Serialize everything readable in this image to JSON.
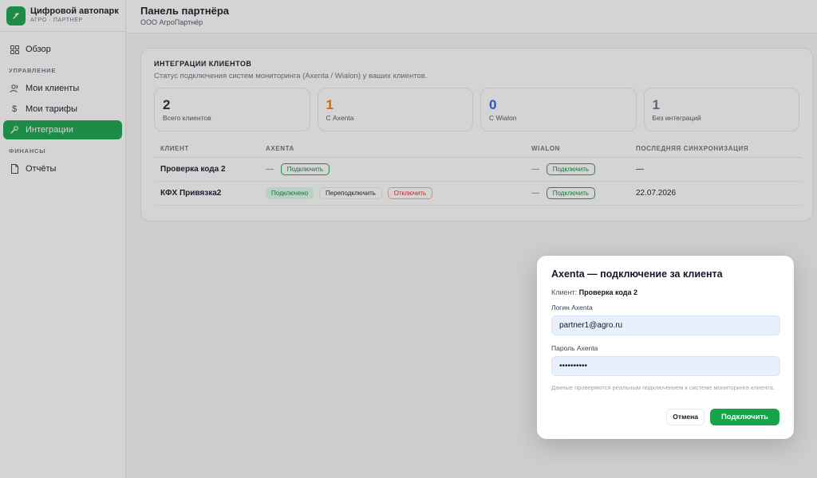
{
  "brand": {
    "title": "Цифровой автопарк",
    "subtitle": "АГРО · ПАРТНЁР"
  },
  "sidebar": {
    "overview": "Обзор",
    "section_manage": "УПРАВЛЕНИЕ",
    "my_clients": "Мои клиенты",
    "my_tariffs": "Мои тарифы",
    "integrations": "Интеграции",
    "section_finance": "ФИНАНСЫ",
    "reports": "Отчёты"
  },
  "header": {
    "title": "Панель партнёра",
    "org": "ООО АгроПартнёр"
  },
  "integrations": {
    "title": "ИНТЕГРАЦИИ КЛИЕНТОВ",
    "description": "Статус подключения систем мониторинга (Axenta / Wialon) у ваших клиентов.",
    "stats": [
      {
        "value": "2",
        "label": "Всего клиентов",
        "color": "#1f2937"
      },
      {
        "value": "1",
        "label": "С Axenta",
        "color": "#ea7a12"
      },
      {
        "value": "0",
        "label": "C Wialon",
        "color": "#2563eb"
      },
      {
        "value": "1",
        "label": "Без интеграций",
        "color": "#64748b"
      }
    ],
    "columns": [
      "КЛИЕНТ",
      "AXENTA",
      "WIALON",
      "ПОСЛЕДНЯЯ СИНХРОНИЗАЦИЯ"
    ],
    "rows": [
      {
        "client": "Проверка кода 2",
        "axenta_dash": "—",
        "axenta_connect": "Подключить",
        "wialon_dash": "—",
        "wialon_connect": "Подключить",
        "last_sync": "—"
      },
      {
        "client": "КФХ Привязка2",
        "axenta_status": "Подключено",
        "axenta_reconnect": "Переподключить",
        "axenta_disconnect": "Отключить",
        "wialon_dash": "—",
        "wialon_connect": "Подключить",
        "last_sync": "22.07.2026"
      }
    ]
  },
  "modal": {
    "title": "Axenta — подключение за клиента",
    "client_label": "Клиент:",
    "client_name": "Проверка кода 2",
    "login_label": "Логин Axenta",
    "login_value": "partner1@agro.ru",
    "password_label": "Пароль Axenta",
    "password_value": "••••••••••",
    "hint": "Данные проверяются реальным подключением к системе мониторинга клиента.",
    "cancel": "Отмена",
    "submit": "Подключить"
  }
}
